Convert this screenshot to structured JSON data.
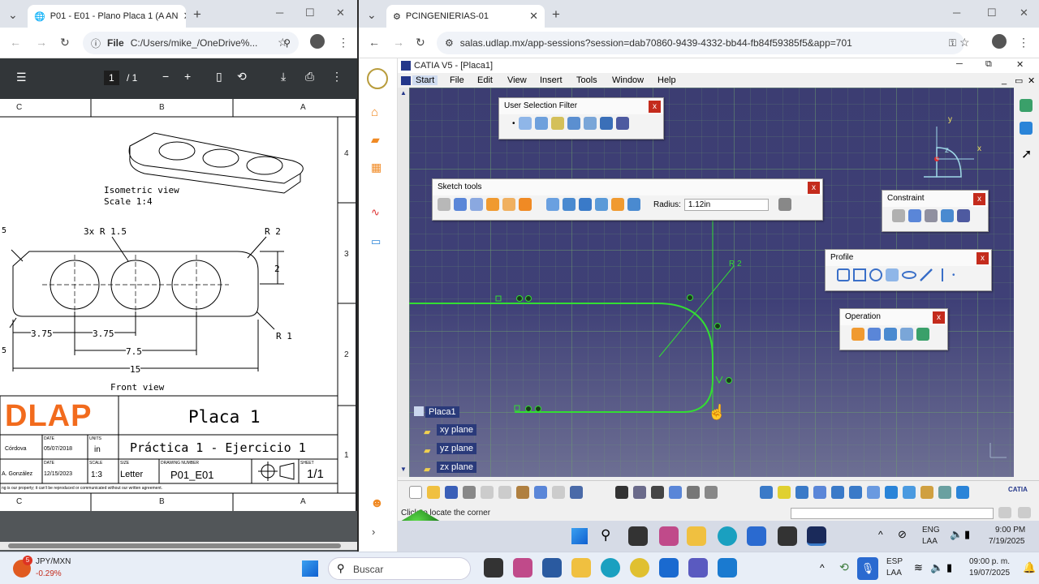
{
  "left_browser": {
    "tab_title": "P01 - E01 - Plano Placa 1 (A AN",
    "address_scheme": "File",
    "address": "C:/Users/mike_/OneDrive%...",
    "pdf_page_current": "1",
    "pdf_page_total": "/ 1"
  },
  "drawing": {
    "col_labels": [
      "C",
      "B",
      "A"
    ],
    "row_labels": [
      "4",
      "3",
      "2",
      "1"
    ],
    "iso_label_1": "Isometric view",
    "iso_label_2": "Scale 1:4",
    "dim_holes": "3x R 1.5",
    "dim_r2": "R 2",
    "dim_2": "2",
    "dim_r1": "R 1",
    "dim_375a": "3.75",
    "dim_375b": "3.75",
    "dim_75": "7.5",
    "dim_15": "15",
    "dim_5a": "5",
    "dim_5b": "5",
    "front_view": "Front view",
    "logo_text": "DLAP",
    "part_name": "Placa 1",
    "subtitle": "Práctica 1 - Ejercicio 1",
    "drawn_by": "Córdova",
    "date1_label": "DATE",
    "date1": "05/07/2018",
    "units_label": "UNITS",
    "units": "in",
    "checked_by": "A. González",
    "date2_label": "DATE",
    "date2": "12/15/2023",
    "scale_label": "SCALE",
    "scale": "1:3",
    "size_label": "SIZE",
    "size": "Letter",
    "drawing_number_label": "DRAWING NUMBER",
    "drawing_number": "P01_E01",
    "sheet_label": "SHEET",
    "sheet": "1/1",
    "footer_note": "ng is our property; it can't be reproduced or communicated without our written agreement."
  },
  "right_browser": {
    "tab_title": "PCINGENIERIAS-01",
    "address": "salas.udlap.mx/app-sessions?session=dab70860-9439-4332-bb44-fb84f59385f5&app=701"
  },
  "catia": {
    "title": "CATIA V5 - [Placa1]",
    "menu": [
      "Start",
      "File",
      "Edit",
      "View",
      "Insert",
      "Tools",
      "Window",
      "Help"
    ],
    "user_selection_filter": "User Selection Filter",
    "sketch_tools": "Sketch tools",
    "radius_label": "Radius:",
    "radius_value": "1.12in",
    "constraint": "Constraint",
    "profile": "Profile",
    "operation": "Operation",
    "sketch_r2_label": "R 2",
    "tree_root": "Placa1",
    "tree_items": [
      "xy plane",
      "yz plane",
      "zx plane"
    ],
    "axis_x": "x",
    "axis_y": "y",
    "axis_z": "z",
    "status_text": "Click to locate the corner",
    "catia_logo": "CATIA"
  },
  "inner_taskbar": {
    "lang": "ENG",
    "lang2": "LAA",
    "time": "9:00 PM",
    "date": "7/19/2025"
  },
  "taskbar": {
    "ticker": "JPY/MXN",
    "ticker_change": "-0.29%",
    "ticker_badge": "5",
    "search_placeholder": "Buscar",
    "lang": "ESP",
    "lang2": "LAA",
    "time": "09:00 p. m.",
    "date": "19/07/2025"
  },
  "colors": {
    "catia_bg": "#3c3d72",
    "sketch_green": "#33dd33",
    "close_red": "#c42b1c",
    "logo_orange": "#f26b1d"
  }
}
